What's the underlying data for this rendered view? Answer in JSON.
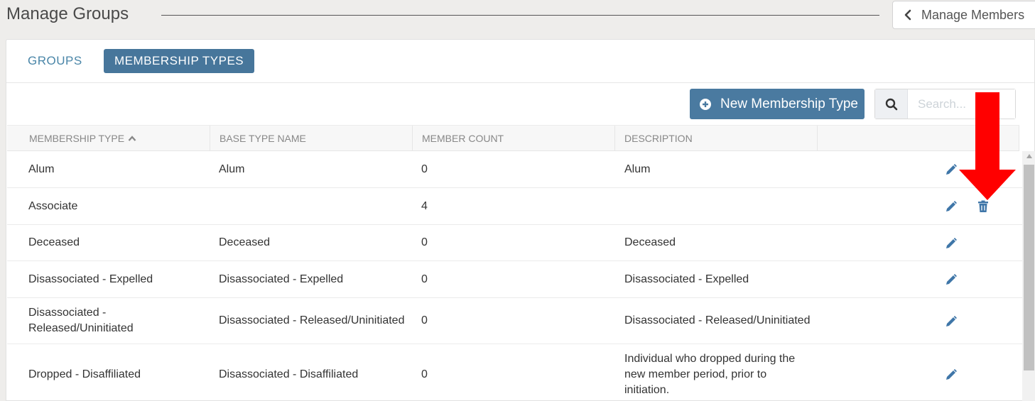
{
  "header": {
    "title": "Manage Groups",
    "back_label": "Manage Members"
  },
  "tabs": [
    {
      "label": "GROUPS",
      "active": false
    },
    {
      "label": "MEMBERSHIP TYPES",
      "active": true
    }
  ],
  "toolbar": {
    "new_button_label": "New Membership Type",
    "search_placeholder": "Search..."
  },
  "table": {
    "columns": [
      "MEMBERSHIP TYPE",
      "BASE TYPE NAME",
      "MEMBER COUNT",
      "DESCRIPTION"
    ],
    "sort": {
      "column": "MEMBERSHIP TYPE",
      "direction": "ascending"
    },
    "rows": [
      {
        "type": "Alum",
        "base": "Alum",
        "count": "0",
        "description": "Alum",
        "deletable": false
      },
      {
        "type": "Associate",
        "base": "",
        "count": "4",
        "description": "",
        "deletable": true
      },
      {
        "type": "Deceased",
        "base": "Deceased",
        "count": "0",
        "description": "Deceased",
        "deletable": false
      },
      {
        "type": "Disassociated - Expelled",
        "base": "Disassociated - Expelled",
        "count": "0",
        "description": "Disassociated - Expelled",
        "deletable": false
      },
      {
        "type": "Disassociated - Released/Uninitiated",
        "base": "Disassociated - Released/Uninitiated",
        "count": "0",
        "description": "Disassociated - Released/Uninitiated",
        "deletable": false
      },
      {
        "type": "Dropped - Disaffiliated",
        "base": "Disassociated - Disaffiliated",
        "count": "0",
        "description": "Individual who dropped during the new member period, prior to initiation.",
        "deletable": false
      }
    ]
  },
  "colors": {
    "accent": "#47769b",
    "tab_text": "#4a86a8",
    "action_icon": "#3f76a8",
    "annotation_arrow": "#ff0000"
  },
  "icons": {
    "back": "chevron-left-icon",
    "new": "plus-circle-icon",
    "search": "search-icon",
    "sort": "caret-up-icon",
    "edit": "pencil-icon",
    "delete": "trash-icon"
  }
}
